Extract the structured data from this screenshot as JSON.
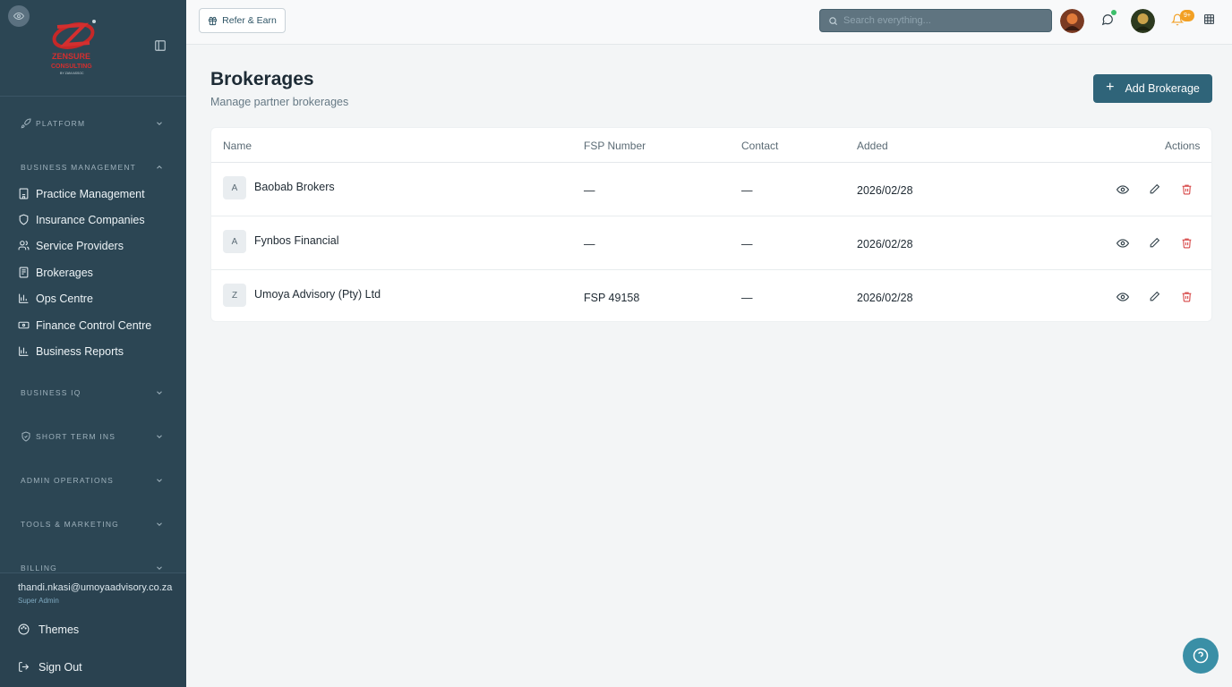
{
  "sidebar": {
    "logo_text": "ZENSURE CONSULTING",
    "sections": {
      "platform": "PLATFORM",
      "business_management": "BUSINESS MANAGEMENT",
      "business_iq": "BUSINESS IQ",
      "short_term_ins": "SHORT TERM INS",
      "admin_operations": "ADMIN OPERATIONS",
      "tools_marketing": "TOOLS & MARKETING",
      "billing": "BILLING"
    },
    "items": [
      {
        "label": "Practice Management",
        "icon": "building-icon"
      },
      {
        "label": "Insurance Companies",
        "icon": "shield-icon"
      },
      {
        "label": "Service Providers",
        "icon": "users-icon"
      },
      {
        "label": "Brokerages",
        "icon": "document-icon"
      },
      {
        "label": "Ops Centre",
        "icon": "bar-chart-icon"
      },
      {
        "label": "Finance Control Centre",
        "icon": "wallet-icon"
      },
      {
        "label": "Business Reports",
        "icon": "bar-chart-icon"
      }
    ],
    "user": {
      "email": "thandi.nkasi@umoyaadvisory.co.za",
      "role": "Super Admin"
    },
    "footer": {
      "themes": "Themes",
      "sign_out": "Sign Out"
    }
  },
  "topbar": {
    "refer_label": "Refer & Earn",
    "search_placeholder": "Search everything...",
    "notification_count": "9+"
  },
  "page": {
    "title": "Brokerages",
    "subtitle": "Manage partner brokerages",
    "add_button": "Add Brokerage"
  },
  "table": {
    "headers": {
      "name": "Name",
      "fsp": "FSP Number",
      "contact": "Contact",
      "added": "Added",
      "actions": "Actions"
    },
    "rows": [
      {
        "initial": "A",
        "name": "Baobab Brokers",
        "fsp": "—",
        "contact": "—",
        "added": "2026/02/28"
      },
      {
        "initial": "A",
        "name": "Fynbos Financial",
        "fsp": "—",
        "contact": "—",
        "added": "2026/02/28"
      },
      {
        "initial": "Z",
        "name": "Umoya Advisory (Pty) Ltd",
        "fsp": "FSP 49158",
        "contact": "—",
        "added": "2026/02/28"
      }
    ]
  },
  "colors": {
    "sidebar": "#2c4654",
    "accent": "#2f6479",
    "danger": "#d64545",
    "help": "#3a8fa6"
  }
}
